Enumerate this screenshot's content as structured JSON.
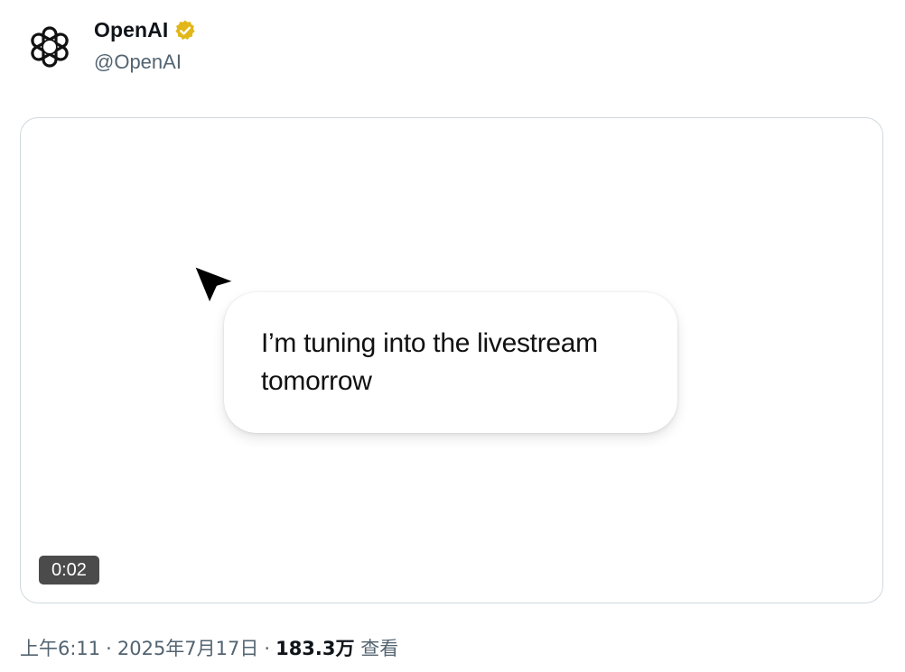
{
  "author": {
    "display_name": "OpenAI",
    "handle": "@OpenAI",
    "avatar_icon": "openai-logo-icon",
    "verified_icon": "verified-badge-icon",
    "verified_color": "#e2b719"
  },
  "media": {
    "bubble_text": "I’m tuning into the livestream tomorrow",
    "duration": "0:02",
    "cursor_icon": "cursor-arrow-icon"
  },
  "meta": {
    "time": "上午6:11",
    "separator": "·",
    "date": "2025年7月17日",
    "views_count": "183.3万",
    "views_label": "查看"
  }
}
